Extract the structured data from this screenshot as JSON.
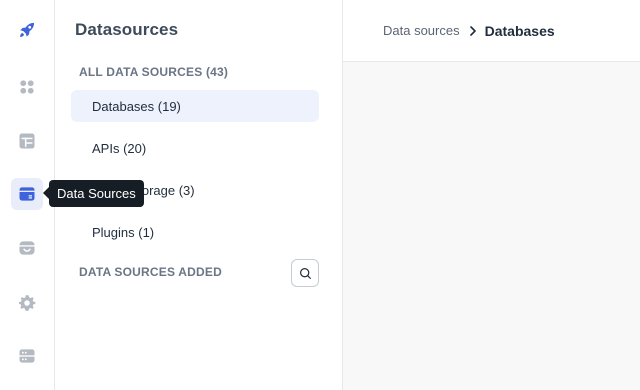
{
  "rail": {
    "items": [
      {
        "name": "rocket-icon",
        "active": false
      },
      {
        "name": "apps-icon",
        "active": false
      },
      {
        "name": "table-icon",
        "active": false
      },
      {
        "name": "datasources-icon",
        "active": true
      },
      {
        "name": "marketplace-icon",
        "active": false
      },
      {
        "name": "gear-icon",
        "active": false
      },
      {
        "name": "server-icon",
        "active": false
      }
    ],
    "tooltip": "Data Sources"
  },
  "panel": {
    "title": "Datasources",
    "all_label": "ALL DATA SOURCES (43)",
    "items": [
      {
        "label": "Databases (19)",
        "active": true
      },
      {
        "label": "APIs (20)",
        "active": false
      },
      {
        "label": "Cloud Storage (3)",
        "active": false
      },
      {
        "label": "Plugins (1)",
        "active": false
      }
    ],
    "added_label": "DATA SOURCES ADDED",
    "search_icon": "search-icon"
  },
  "breadcrumb": {
    "parent": "Data sources",
    "separator_icon": "chevron-right-icon",
    "current": "Databases"
  },
  "colors": {
    "accent": "#3e63dd",
    "active_bg": "#eef2fc",
    "icon_gray": "#b4bac2",
    "tooltip_bg": "#171d25"
  }
}
